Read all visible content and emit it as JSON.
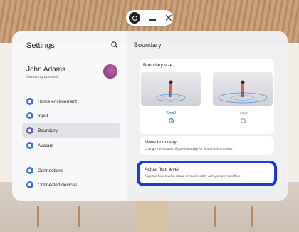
{
  "settings": {
    "title": "Settings",
    "profile": {
      "name": "John Adams",
      "subtitle": "Samsung account"
    },
    "menu": [
      {
        "label": "Home environment",
        "icon": "home-icon",
        "color": "#3d6fd9"
      },
      {
        "label": "Input",
        "icon": "input-icon",
        "color": "#3d6fd9"
      },
      {
        "label": "Boundary",
        "icon": "boundary-icon",
        "color": "#6a5acd",
        "active": true
      },
      {
        "label": "Avatars",
        "icon": "avatar-icon",
        "color": "#3d6fd9"
      },
      {
        "label": "Connections",
        "icon": "wifi-icon",
        "color": "#3d6fd9"
      },
      {
        "label": "Connected devices",
        "icon": "devices-icon",
        "color": "#3d6fd9"
      }
    ]
  },
  "boundary": {
    "title": "Boundary",
    "size": {
      "title": "Boundary size",
      "options": [
        {
          "label": "Small",
          "selected": true,
          "color": "#1a5dd6"
        },
        {
          "label": "Large",
          "selected": false,
          "color": "#999999"
        }
      ]
    },
    "move": {
      "title": "Move boundary",
      "description": "Change the location of your boundary for virtual environments."
    },
    "floor": {
      "title": "Adjust floor level",
      "description": "Align the floor level in virtual or mixed reality with your physical floor."
    }
  }
}
